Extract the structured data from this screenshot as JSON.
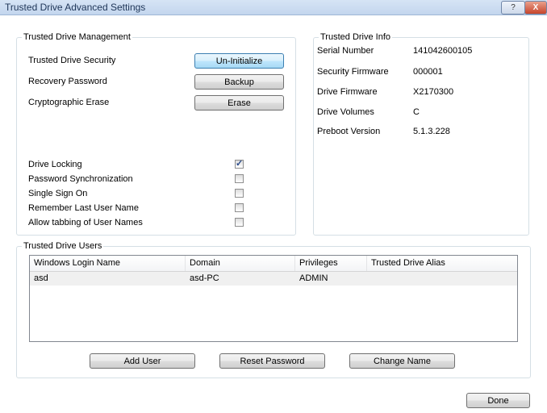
{
  "window": {
    "title": "Trusted Drive Advanced Settings",
    "help_label": "?",
    "close_label": "X"
  },
  "management": {
    "legend": "Trusted Drive Management",
    "actions": [
      {
        "label": "Trusted Drive Security",
        "button": "Un-Initialize"
      },
      {
        "label": "Recovery Password",
        "button": "Backup"
      },
      {
        "label": "Cryptographic Erase",
        "button": "Erase"
      }
    ],
    "options": [
      {
        "label": "Drive Locking",
        "checked": true
      },
      {
        "label": "Password Synchronization",
        "checked": false
      },
      {
        "label": "Single Sign On",
        "checked": false
      },
      {
        "label": "Remember Last User Name",
        "checked": false
      },
      {
        "label": "Allow tabbing of User Names",
        "checked": false
      }
    ]
  },
  "info": {
    "legend": "Trusted Drive Info",
    "rows": [
      {
        "label": "Serial Number",
        "value": "141042600105"
      },
      {
        "label": "Security Firmware",
        "value": "000001"
      },
      {
        "label": "Drive Firmware",
        "value": "X2170300"
      },
      {
        "label": "Drive Volumes",
        "value": "C"
      },
      {
        "label": "Preboot Version",
        "value": "5.1.3.228"
      }
    ]
  },
  "users": {
    "legend": "Trusted Drive Users",
    "columns": [
      "Windows Login Name",
      "Domain",
      "Privileges",
      "Trusted Drive Alias"
    ],
    "rows": [
      [
        "asd",
        "asd-PC",
        "ADMIN",
        ""
      ]
    ],
    "buttons": {
      "add": "Add User",
      "reset": "Reset Password",
      "rename": "Change Name"
    }
  },
  "footer": {
    "done": "Done"
  }
}
